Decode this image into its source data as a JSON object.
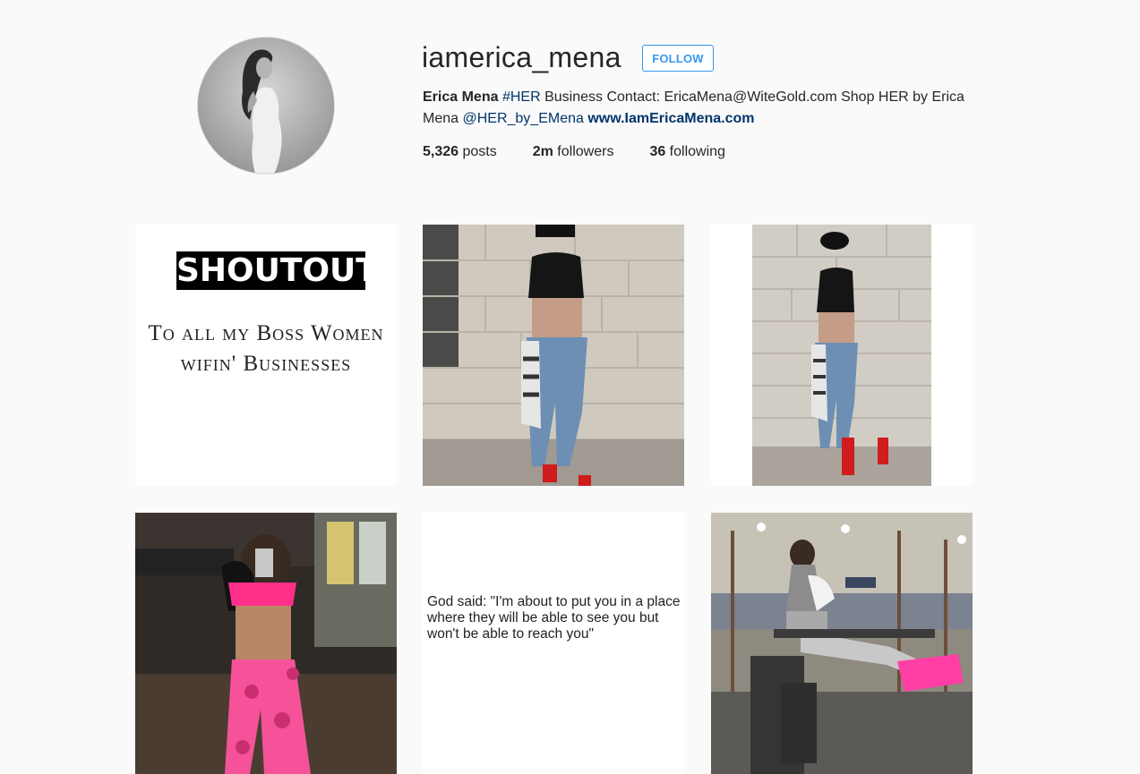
{
  "profile": {
    "username": "iamerica_mena",
    "follow_label": "FOLLOW",
    "bio": {
      "name": "Erica Mena",
      "hashtag": "#HER",
      "text1": " Business Contact: EricaMena@WiteGold.com Shop HER by Erica Mena ",
      "mention": "@HER_by_EMena",
      "space": " ",
      "website": "www.IamEricaMena.com"
    },
    "stats": {
      "posts_count": "5,326",
      "posts_label": " posts",
      "followers_count": "2m",
      "followers_label": " followers",
      "following_count": "36",
      "following_label": " following"
    }
  },
  "posts": {
    "shoutout": {
      "title": "SHOUTOUT",
      "line1": "To all my Boss Women",
      "line2": "wifin' Businesses"
    },
    "quote": {
      "text": "God said: \"I'm about to put you in a place where they will be able to see you but won't be able to reach you\""
    }
  },
  "colors": {
    "accent": "#3897f0",
    "link": "#003569",
    "background": "#fafafa"
  }
}
